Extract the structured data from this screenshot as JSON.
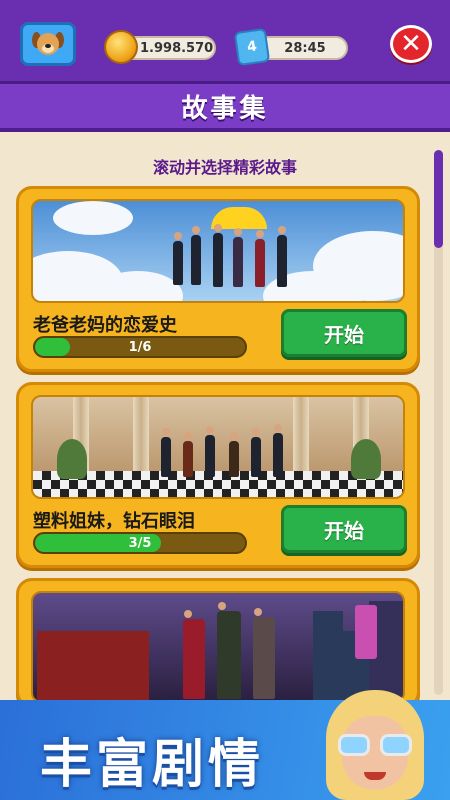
{
  "header": {
    "coins": "1.998.570",
    "ticket_icon_text": "4",
    "timer": "28:45",
    "close_symbol": "✕"
  },
  "title": "故事集",
  "subtitle": "滚动并选择精彩故事",
  "stories": [
    {
      "title": "老爸老妈的恋爱史",
      "progress": "1/6",
      "progress_fraction": 0.1667,
      "button": "开始"
    },
    {
      "title": "塑料姐妹，钻石眼泪",
      "progress": "3/5",
      "progress_fraction": 0.6,
      "button": "开始"
    },
    {
      "title": "",
      "progress": "",
      "button": ""
    }
  ],
  "promo": {
    "text": "丰富剧情"
  },
  "colors": {
    "accent_purple": "#6a2fb0",
    "card_gold": "#f6b41e",
    "button_green": "#29b24a",
    "progress_green": "#2fbf3a",
    "close_red": "#e3262b"
  }
}
